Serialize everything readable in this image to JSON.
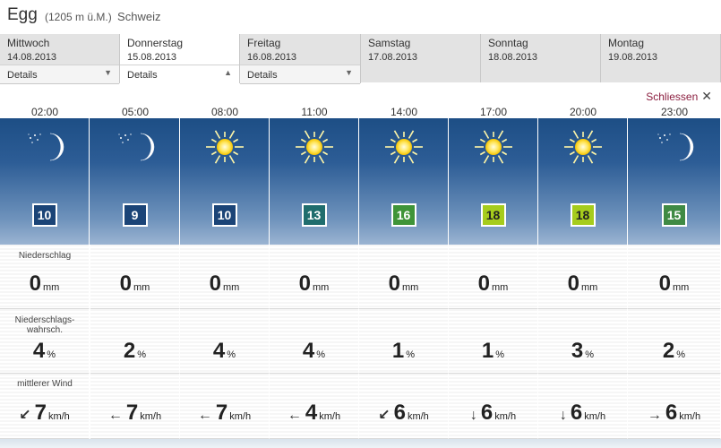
{
  "location": {
    "name": "Egg",
    "altitude": "(1205 m ü.M.)",
    "country": "Schweiz"
  },
  "days": [
    {
      "name": "Mittwoch",
      "date": "14.08.2013",
      "details": "Details",
      "active": false
    },
    {
      "name": "Donnerstag",
      "date": "15.08.2013",
      "details": "Details",
      "active": true
    },
    {
      "name": "Freitag",
      "date": "16.08.2013",
      "details": "Details",
      "active": false
    },
    {
      "name": "Samstag",
      "date": "17.08.2013"
    },
    {
      "name": "Sonntag",
      "date": "18.08.2013"
    },
    {
      "name": "Montag",
      "date": "19.08.2013"
    }
  ],
  "close_label": "Schliessen",
  "labels": {
    "precip": "Niederschlag",
    "precip_prob": "Niederschlags-\nwahrsch.",
    "wind": "mittlerer Wind"
  },
  "units": {
    "precip": "mm",
    "prob": "%",
    "wind": "km/h"
  },
  "forecast": [
    {
      "time": "02:00",
      "icon": "moon-stars-icon",
      "temp": "10",
      "temp_color": "#1b4477",
      "precip": "0",
      "prob": "4",
      "wind": "7",
      "wind_dir": "↙"
    },
    {
      "time": "05:00",
      "icon": "moon-stars-icon",
      "temp": "9",
      "temp_color": "#1b4477",
      "precip": "0",
      "prob": "2",
      "wind": "7",
      "wind_dir": "←"
    },
    {
      "time": "08:00",
      "icon": "sun-icon",
      "temp": "10",
      "temp_color": "#1b4477",
      "precip": "0",
      "prob": "4",
      "wind": "7",
      "wind_dir": "←"
    },
    {
      "time": "11:00",
      "icon": "sun-icon",
      "temp": "13",
      "temp_color": "#1f6d6d",
      "precip": "0",
      "prob": "4",
      "wind": "4",
      "wind_dir": "←"
    },
    {
      "time": "14:00",
      "icon": "sun-icon",
      "temp": "16",
      "temp_color": "#3f9438",
      "precip": "0",
      "prob": "1",
      "wind": "6",
      "wind_dir": "↙"
    },
    {
      "time": "17:00",
      "icon": "sun-icon",
      "temp": "18",
      "temp_color": "#a6cc1c",
      "precip": "0",
      "prob": "1",
      "wind": "6",
      "wind_dir": "↓"
    },
    {
      "time": "20:00",
      "icon": "sun-icon",
      "temp": "18",
      "temp_color": "#a6cc1c",
      "precip": "0",
      "prob": "3",
      "wind": "6",
      "wind_dir": "↓"
    },
    {
      "time": "23:00",
      "icon": "moon-stars-icon",
      "temp": "15",
      "temp_color": "#3f8a44",
      "precip": "0",
      "prob": "2",
      "wind": "6",
      "wind_dir": "→"
    }
  ]
}
